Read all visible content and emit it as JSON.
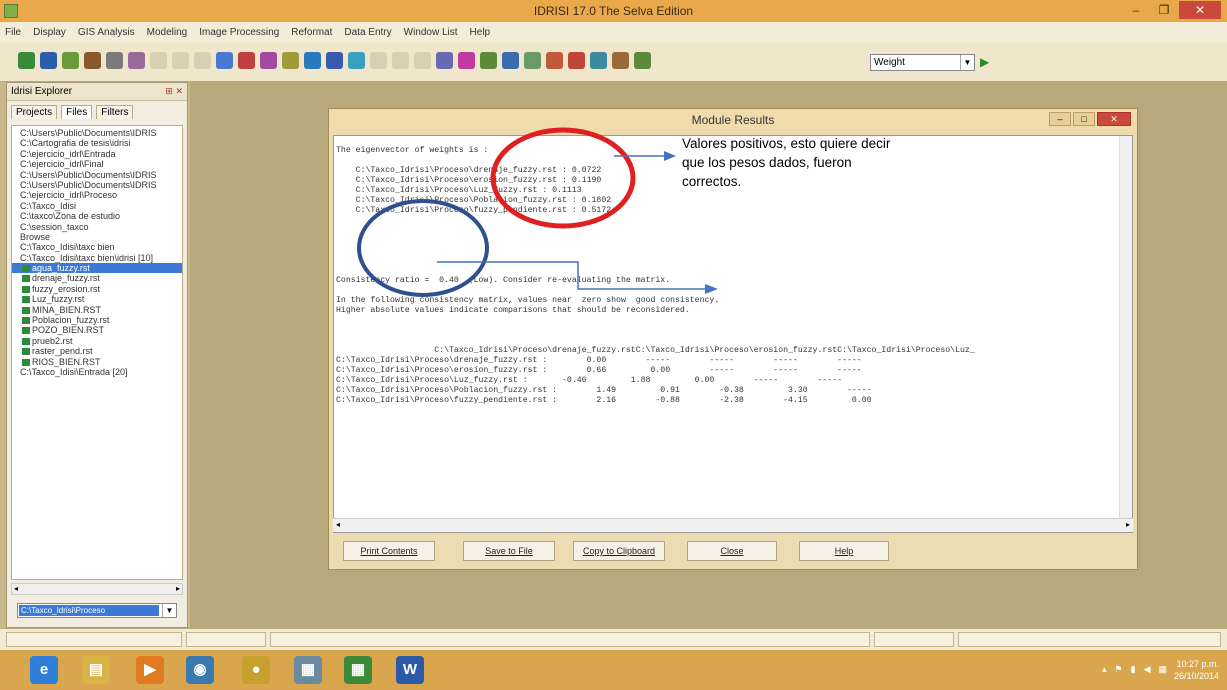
{
  "app": {
    "title": "IDRISI 17.0    The Selva Edition"
  },
  "menu": [
    "File",
    "Display",
    "GIS Analysis",
    "Modeling",
    "Image Processing",
    "Reformat",
    "Data Entry",
    "Window List",
    "Help"
  ],
  "toolbar": {
    "icon_colors": [
      "#3a8a3a",
      "#2d5fa8",
      "#6a9a3a",
      "#8a5a2a",
      "#7a7a7a",
      "#9a6a9a",
      "#d8d0b0",
      "#d8d0b0",
      "#d8d0b0",
      "#4a7ad0",
      "#c04040",
      "#a04aa0",
      "#a09a3a",
      "#2a7ac0",
      "#3a5ab0",
      "#3aa0c0",
      "#d8d0b0",
      "#d8d0b0",
      "#d8d0b0",
      "#6a6ab0",
      "#c03aa0",
      "#5a8a3a",
      "#3a6ab0",
      "#6a9a6a",
      "#c05a3a",
      "#c0463a",
      "#3a8aa0",
      "#9a6a3a",
      "#5a8a3a"
    ],
    "select_value": "Weight",
    "go_icon": "▶"
  },
  "explorer": {
    "title": "Idrisi Explorer",
    "tabs": [
      "Projects",
      "Files",
      "Filters"
    ],
    "items": [
      "C:\\Users\\Public\\Documents\\IDRIS",
      "C:\\Cartografia de tesis\\idrisi",
      "C:\\ejercicio_idrl\\Entrada",
      "C:\\ejercicio_idrl\\Final",
      "C:\\Users\\Public\\Documents\\IDRIS",
      "C:\\Users\\Public\\Documents\\IDRIS",
      "C:\\ejercicio_idrl\\Proceso",
      "C:\\Taxco_Idisi",
      "C:\\taxco\\Zona de estudio",
      "C:\\session_taxco",
      "Browse",
      "C:\\Taxco_Idisi\\taxc bien",
      "C:\\Taxco_Idisi\\taxc bien\\idrisi [10]"
    ],
    "files": [
      "agua_fuzzy.rst",
      "drenaje_fuzzy.rst",
      "fuzzy_erosion.rst",
      "Luz_fuzzy.rst",
      "MINA_BIEN.RST",
      "Poblacion_fuzzy.rst",
      "POZO_BIEN.RST",
      "prueb2.rst",
      "raster_pend.rst",
      "RIOS_BIEN.RST"
    ],
    "last_item": "C:\\Taxco_Idisi\\Entrada [20]",
    "combo_value": "C:\\Taxco_Idrisi\\Proceso"
  },
  "module": {
    "title": "Module Results",
    "text_lines": [
      "",
      "The eigenvector of weights is :",
      "",
      "    C:\\Taxco_Idrisi\\Proceso\\drenaje_fuzzy.rst : 0.0722",
      "    C:\\Taxco_Idrisi\\Proceso\\erosion_fuzzy.rst : 0.1190",
      "    C:\\Taxco_Idrisi\\Proceso\\Luz_fuzzy.rst : 0.1113",
      "    C:\\Taxco_Idrisi\\Proceso\\Poblacion_fuzzy.rst : 0.1802",
      "    C:\\Taxco_Idrisi\\Proceso\\fuzzy_pendiente.rst : 0.5172",
      "",
      "",
      "",
      "",
      "",
      "",
      "Consistency ratio =  0.40  (Low). Consider re-evaluating the matrix.",
      "",
      "In the following consistency matrix, values near  zero show  good consistency.",
      "Higher absolute values indicate comparisons that should be reconsidered.",
      "",
      "",
      "",
      "                    C:\\Taxco_Idrisi\\Proceso\\drenaje_fuzzy.rstC:\\Taxco_Idrisi\\Proceso\\erosion_fuzzy.rstC:\\Taxco_Idrisi\\Proceso\\Luz_",
      "C:\\Taxco_Idrisi\\Proceso\\drenaje_fuzzy.rst :        0.00        -----        -----        -----        -----",
      "C:\\Taxco_Idrisi\\Proceso\\erosion_fuzzy.rst :        0.66         0.00        -----        -----        -----",
      "C:\\Taxco_Idrisi\\Proceso\\Luz_fuzzy.rst :       -0.46         1.88         0.00        -----        -----",
      "C:\\Taxco_Idrisi\\Proceso\\Poblacion_fuzzy.rst :        1.49         0.91        -0.38         3.30        -----",
      "C:\\Taxco_Idrisi\\Proceso\\fuzzy_pendiente.rst :        2.16        -0.88        -2.38        -4.15         0.00"
    ],
    "buttons": [
      "Print Contents",
      "Save to File",
      "Copy to Clipboard",
      "Close",
      "Help"
    ]
  },
  "annotation": {
    "text": "Valores positivos, esto quiere decir que los pesos dados, fueron correctos.",
    "red_color": "#e02020",
    "blue_color": "#2f4f8f",
    "arrow_color": "#4472c4"
  },
  "taskbar": {
    "icons": [
      {
        "name": "ie",
        "color": "#2f7fd8",
        "glyph": "e"
      },
      {
        "name": "explorer",
        "color": "#d9b24a",
        "glyph": "▤"
      },
      {
        "name": "media",
        "color": "#e07a20",
        "glyph": "▶"
      },
      {
        "name": "app",
        "color": "#3a7ab0",
        "glyph": "◉"
      },
      {
        "name": "chrome",
        "color": "#c8a030",
        "glyph": "●"
      },
      {
        "name": "app",
        "color": "#6a8aa0",
        "glyph": "▦"
      },
      {
        "name": "idrisi",
        "color": "#3a8a3a",
        "glyph": "▦"
      },
      {
        "name": "word",
        "color": "#2a5aa8",
        "glyph": "W"
      }
    ],
    "clock_time": "10:27 p.m.",
    "clock_date": "26/10/2014"
  }
}
